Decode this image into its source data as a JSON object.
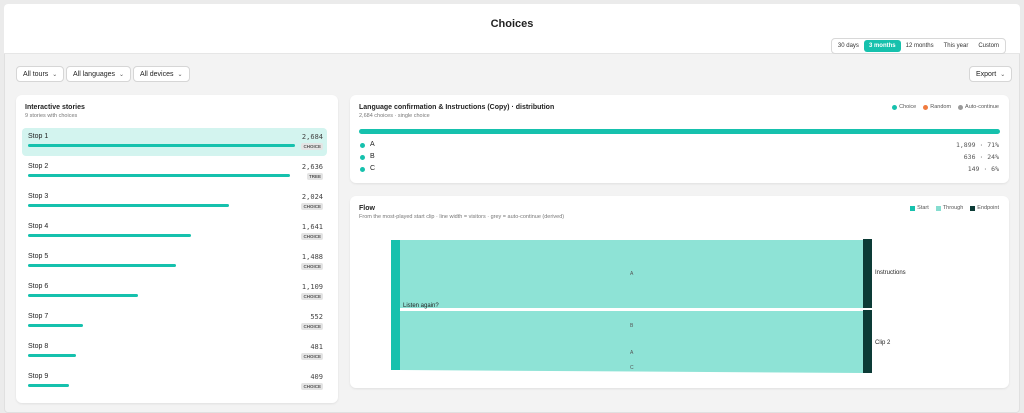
{
  "page_title": "Choices",
  "range": {
    "options": [
      "30 days",
      "3 months",
      "12 months",
      "This year",
      "Custom"
    ],
    "active": 1
  },
  "filters": {
    "tours": "All tours",
    "languages": "All languages",
    "devices": "All devices"
  },
  "export_label": "Export",
  "stories": {
    "title": "Interactive stories",
    "subtitle": "9 stories with choices",
    "items": [
      {
        "name": "Stop 1",
        "value": "2,684",
        "tag": "CHOICE",
        "ratio": 1.0
      },
      {
        "name": "Stop 2",
        "value": "2,636",
        "tag": "TREE",
        "ratio": 0.982
      },
      {
        "name": "Stop 3",
        "value": "2,024",
        "tag": "CHOICE",
        "ratio": 0.754
      },
      {
        "name": "Stop 4",
        "value": "1,641",
        "tag": "CHOICE",
        "ratio": 0.611
      },
      {
        "name": "Stop 5",
        "value": "1,488",
        "tag": "CHOICE",
        "ratio": 0.554
      },
      {
        "name": "Stop 6",
        "value": "1,109",
        "tag": "CHOICE",
        "ratio": 0.413
      },
      {
        "name": "Stop 7",
        "value": "552",
        "tag": "CHOICE",
        "ratio": 0.206
      },
      {
        "name": "Stop 8",
        "value": "481",
        "tag": "CHOICE",
        "ratio": 0.179
      },
      {
        "name": "Stop 9",
        "value": "409",
        "tag": "CHOICE",
        "ratio": 0.152
      }
    ]
  },
  "distribution": {
    "title": "Language confirmation & Instructions (Copy) · distribution",
    "subtitle": "2,684 choices · single choice",
    "legend": [
      {
        "label": "Choice",
        "color": "#16c1ad"
      },
      {
        "label": "Random",
        "color": "#f07b3f"
      },
      {
        "label": "Auto-continue",
        "color": "#9a9a9a"
      }
    ],
    "options": [
      {
        "label": "A",
        "value": "1,899 · 71%"
      },
      {
        "label": "B",
        "value": "636 · 24%"
      },
      {
        "label": "C",
        "value": "149 · 6%"
      }
    ]
  },
  "flow": {
    "title": "Flow",
    "subtitle": "From the most-played start clip · line width = visitors · grey = auto-continue (derived)",
    "legend": [
      {
        "label": "Start",
        "color": "#16c1ad"
      },
      {
        "label": "Through",
        "color": "#86ddd0"
      },
      {
        "label": "Endpoint",
        "color": "#0c3b36"
      }
    ],
    "source_label": "Listen again?",
    "targets": [
      "Instructions",
      "Clip 2"
    ],
    "link_labels": [
      "A",
      "B",
      "A",
      "C"
    ]
  },
  "colors": {
    "accent": "#16c1ad",
    "link": "#8ee3d6",
    "endpoint": "#0c3b36"
  }
}
